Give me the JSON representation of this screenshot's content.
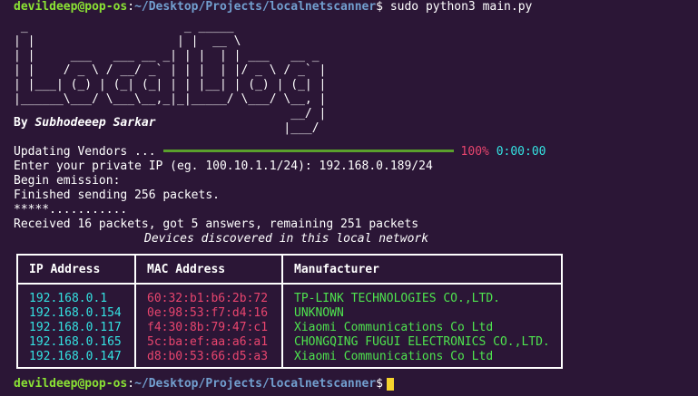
{
  "prompt": {
    "user_host": "devildeep@pop-os",
    "separator": ":",
    "path": "~/Desktop/Projects/localnetscanner",
    "symbol": "$",
    "command": " sudo python3 main.py"
  },
  "banner": " _                      _ _____\n| |                    | |  __ \\\n| |     ___   ___ __ _| | |  | | ___   __ _\n| |    / _ \\ / __/ _` | | |  | |/ _ \\ / _` |\n| |___| (_) | (_| (_| | | |__| | (_) | (_| |\n|______\\___/ \\___\\__,_|_|_____/ \\___/ \\__, |\n                                       __/ |\n                                      |___/",
  "author": {
    "by": "By ",
    "name": "Subhodeeep Sarkar"
  },
  "progress": {
    "label": "Updating Vendors ...",
    "percent_text": "100%",
    "time": "0:00:00",
    "fraction": 1.0
  },
  "output": [
    "Enter your private IP (eg. 100.10.1.1/24): 192.168.0.189/24",
    "Begin emission:",
    "Finished sending 256 packets.",
    "*****...........",
    "Received 16 packets, got 5 answers, remaining 251 packets"
  ],
  "table": {
    "caption": "Devices discovered in this local network",
    "headers": [
      "IP Address",
      "MAC Address",
      "Manufacturer"
    ],
    "rows": [
      [
        "192.168.0.1",
        "60:32:b1:b6:2b:72",
        "TP-LINK TECHNOLOGIES CO.,LTD."
      ],
      [
        "192.168.0.154",
        "0e:98:53:f7:d4:16",
        "UNKNOWN"
      ],
      [
        "192.168.0.117",
        "f4:30:8b:79:47:c1",
        "Xiaomi Communications Co Ltd"
      ],
      [
        "192.168.0.165",
        "5c:ba:ef:aa:a6:a1",
        "CHONGQING FUGUI ELECTRONICS CO.,LTD."
      ],
      [
        "192.168.0.147",
        "d8:b0:53:66:d5:a3",
        "Xiaomi Communications Co Ltd"
      ]
    ]
  },
  "colors": {
    "background": "#2b1636",
    "user": "#8ae234",
    "path": "#729fcf",
    "ip": "#34e2e2",
    "mac": "#e8456e",
    "manufacturer": "#4ee34e",
    "bar": "#5aa02c",
    "cursor": "#f6d32d"
  }
}
